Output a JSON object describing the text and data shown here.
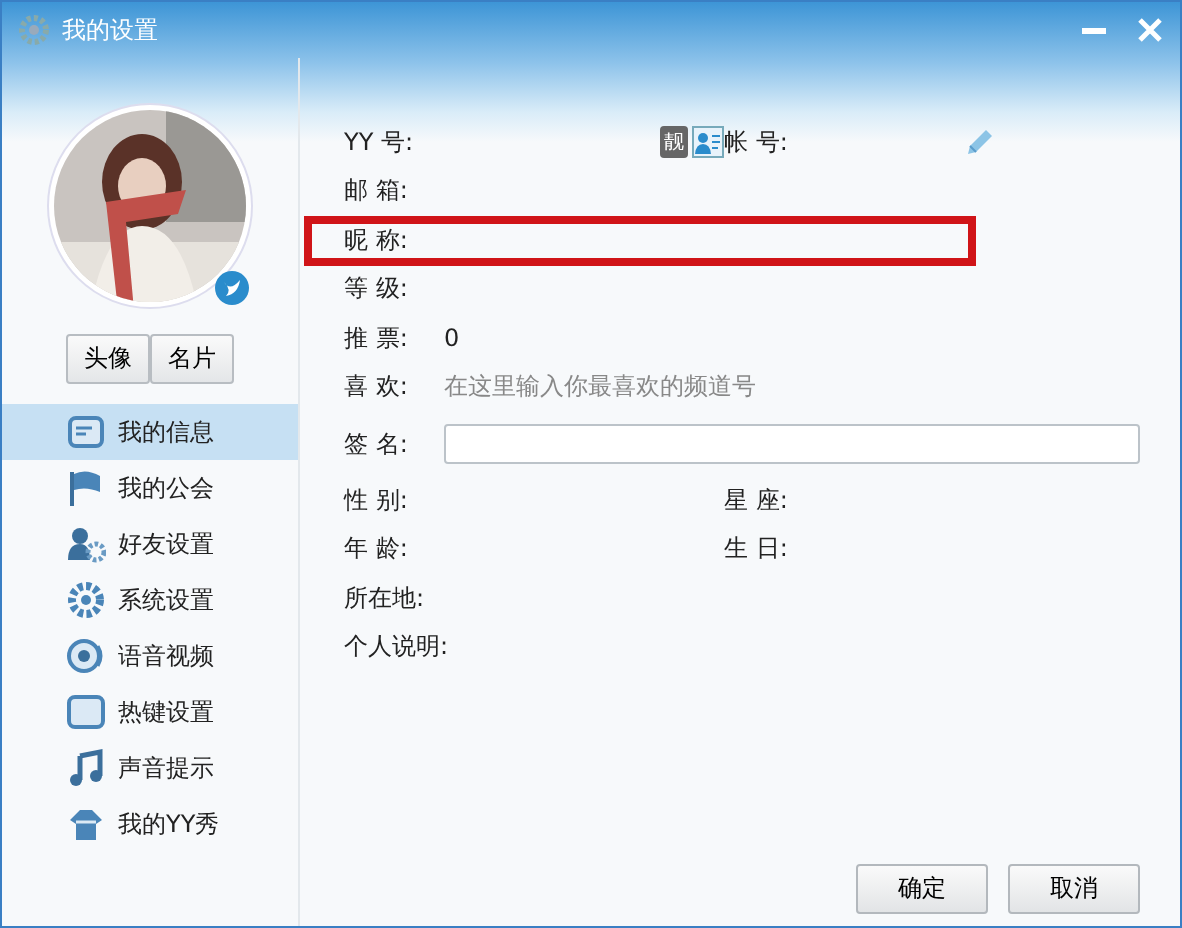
{
  "window": {
    "title": "我的设置"
  },
  "avatar_buttons": [
    "头像",
    "名片"
  ],
  "sidebar": {
    "items": [
      {
        "label": "我的信息",
        "selected": true
      },
      {
        "label": "我的公会",
        "selected": false
      },
      {
        "label": "好友设置",
        "selected": false
      },
      {
        "label": "系统设置",
        "selected": false
      },
      {
        "label": "语音视频",
        "selected": false
      },
      {
        "label": "热键设置",
        "selected": false
      },
      {
        "label": "声音提示",
        "selected": false
      },
      {
        "label": "我的YY秀",
        "selected": false
      }
    ]
  },
  "fields": [
    {
      "kind": "pair",
      "label": "YY 号:",
      "badge": "靓",
      "label_2": "帐 号:",
      "highlighted": false
    },
    {
      "kind": "text",
      "label": "邮 箱:",
      "highlighted": false
    },
    {
      "kind": "text",
      "label": "昵 称:",
      "highlighted": true
    },
    {
      "kind": "text",
      "label": "等 级:",
      "highlighted": false
    },
    {
      "kind": "text",
      "label": "推 票:",
      "value": "0",
      "highlighted": false
    },
    {
      "kind": "hint",
      "label": "喜 欢:",
      "value": "在这里输入你最喜欢的频道号",
      "highlighted": false
    },
    {
      "kind": "input",
      "label": "签 名:",
      "highlighted": false
    },
    {
      "kind": "pair",
      "label": "性 别:",
      "label_2": "星 座:",
      "highlighted": false
    },
    {
      "kind": "pair",
      "label": "年 龄:",
      "label_2": "生 日:",
      "highlighted": false
    },
    {
      "kind": "text",
      "label": "所在地:",
      "highlighted": false
    },
    {
      "kind": "text",
      "label": "个人说明:",
      "highlighted": false
    }
  ],
  "buttons": [
    "确定",
    "取消"
  ]
}
